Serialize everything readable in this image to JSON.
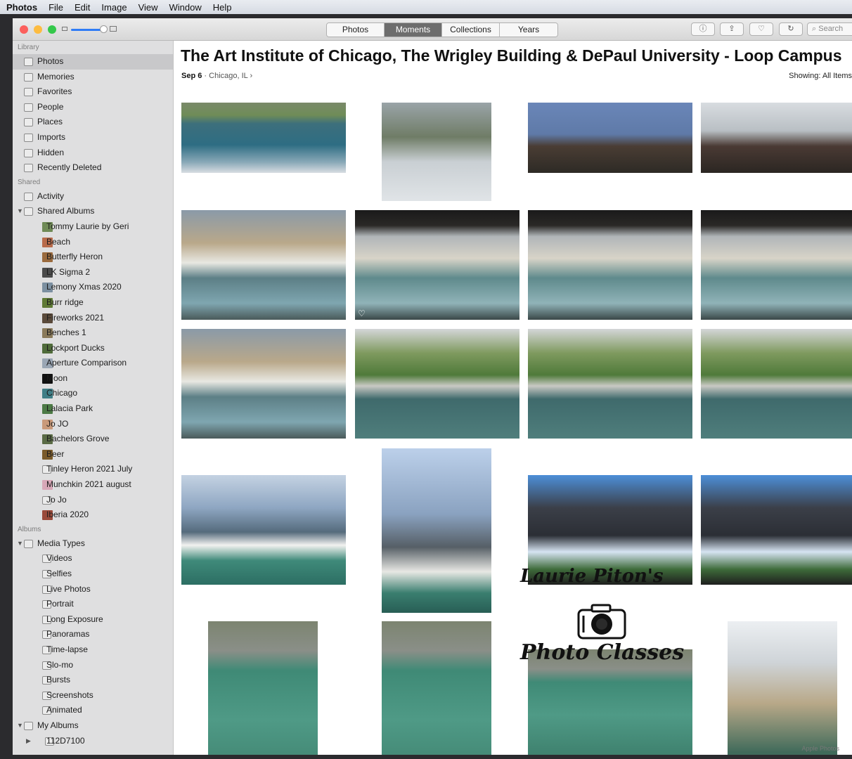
{
  "menubar": {
    "app_name": "Photos",
    "items": [
      "File",
      "Edit",
      "Image",
      "View",
      "Window",
      "Help"
    ]
  },
  "toolbar": {
    "tabs": [
      "Photos",
      "Moments",
      "Collections",
      "Years"
    ],
    "active_tab": "Moments",
    "buttons": [
      {
        "name": "info-button",
        "icon": "info-icon",
        "glyph": "ⓘ"
      },
      {
        "name": "share-button",
        "icon": "share-icon",
        "glyph": "⇪"
      },
      {
        "name": "favorite-button",
        "icon": "heart-icon",
        "glyph": "♡"
      },
      {
        "name": "rotate-button",
        "icon": "rotate-icon",
        "glyph": "↻"
      }
    ],
    "search_placeholder": "Search"
  },
  "sidebar": {
    "sections": [
      {
        "header": "Library",
        "items": [
          {
            "label": "Photos",
            "icon": "photos-icon",
            "selected": true
          },
          {
            "label": "Memories",
            "icon": "memories-icon"
          },
          {
            "label": "Favorites",
            "icon": "heart-icon"
          },
          {
            "label": "People",
            "icon": "person-icon"
          },
          {
            "label": "Places",
            "icon": "pin-icon"
          },
          {
            "label": "Imports",
            "icon": "clock-icon"
          },
          {
            "label": "Hidden",
            "icon": "hidden-icon"
          },
          {
            "label": "Recently Deleted",
            "icon": "trash-icon"
          }
        ]
      },
      {
        "header": "Shared",
        "items": [
          {
            "label": "Activity",
            "icon": "cloud-icon"
          },
          {
            "label": "Shared Albums",
            "icon": "folder-icon",
            "disclosure": "open"
          },
          {
            "label": "Tommy Laurie by Geri",
            "thumb": "#6f8a56",
            "indent": 1
          },
          {
            "label": "Beach",
            "thumb": "#b86b4b",
            "indent": 1
          },
          {
            "label": "Butterfly Heron",
            "thumb": "#9a6a3d",
            "indent": 1
          },
          {
            "label": "LK Sigma 2",
            "thumb": "#4a4a4a",
            "indent": 1
          },
          {
            "label": "Lemony Xmas 2020",
            "thumb": "#7b8fa0",
            "indent": 1
          },
          {
            "label": "Burr ridge",
            "thumb": "#5f7a35",
            "indent": 1
          },
          {
            "label": "Fireworks 2021",
            "thumb": "#5a4a3a",
            "indent": 1
          },
          {
            "label": "Benches 1",
            "thumb": "#8a7a5a",
            "indent": 1
          },
          {
            "label": "Lockport Ducks",
            "thumb": "#4f6b3a",
            "indent": 1
          },
          {
            "label": "Aperture Comparison",
            "thumb": "#9aa6b4",
            "indent": 1
          },
          {
            "label": "Moon",
            "thumb": "#111111",
            "indent": 1
          },
          {
            "label": "Chicago",
            "thumb": "#3f7e86",
            "indent": 1
          },
          {
            "label": "Lalacia Park",
            "thumb": "#4c7a45",
            "indent": 1
          },
          {
            "label": "Jo JO",
            "thumb": "#c99a7a",
            "indent": 1
          },
          {
            "label": "Bachelors Grove",
            "thumb": "#5a6b45",
            "indent": 1
          },
          {
            "label": "Beer",
            "thumb": "#7a5a2a",
            "indent": 1
          },
          {
            "label": "Tinley Heron 2021 July",
            "icon": "album-icon",
            "indent": 1
          },
          {
            "label": "Munchkin 2021 august",
            "thumb": "#d8a8b8",
            "indent": 1
          },
          {
            "label": "Jo Jo",
            "icon": "album-icon",
            "indent": 1
          },
          {
            "label": "Iberia 2020",
            "thumb": "#9a4a3a",
            "indent": 1
          }
        ]
      },
      {
        "header": "Albums",
        "items": [
          {
            "label": "Media Types",
            "icon": "folder-icon",
            "disclosure": "open"
          },
          {
            "label": "Videos",
            "icon": "video-icon",
            "indent": 1
          },
          {
            "label": "Selfies",
            "icon": "camera-icon",
            "indent": 1
          },
          {
            "label": "Live Photos",
            "icon": "live-icon",
            "indent": 1
          },
          {
            "label": "Portrait",
            "icon": "cube-icon",
            "indent": 1
          },
          {
            "label": "Long Exposure",
            "icon": "exposure-icon",
            "indent": 1
          },
          {
            "label": "Panoramas",
            "icon": "panorama-icon",
            "indent": 1
          },
          {
            "label": "Time-lapse",
            "icon": "timelapse-icon",
            "indent": 1
          },
          {
            "label": "Slo-mo",
            "icon": "slomo-icon",
            "indent": 1
          },
          {
            "label": "Bursts",
            "icon": "bursts-icon",
            "indent": 1
          },
          {
            "label": "Screenshots",
            "icon": "phone-icon",
            "indent": 1
          },
          {
            "label": "Animated",
            "icon": "animated-icon",
            "indent": 1
          },
          {
            "label": "My Albums",
            "icon": "folder-icon",
            "disclosure": "open"
          },
          {
            "label": "112D7100",
            "icon": "folder-icon",
            "indent": 1,
            "disclosure": "closed"
          }
        ]
      }
    ]
  },
  "moment": {
    "title": "The Art Institute of Chicago, The Wrigley Building & DePaul University - Loop Campus",
    "date": "Sep 6",
    "separator": "·",
    "location": "Chicago, IL",
    "chevron": "›",
    "showing": "Showing: All Items"
  },
  "watermark": {
    "line1": "Laurie Piton's",
    "line2": "Photo Classes"
  },
  "credit": "Apple Photos",
  "photos": [
    {
      "scene": "river-boats",
      "favorite": false
    },
    {
      "scene": "street-walker",
      "favorite": false
    },
    {
      "scene": "bridge-towers",
      "favorite": false
    },
    {
      "scene": "bridge-facade",
      "favorite": false
    },
    {
      "scene": "riverboat",
      "favorite": false
    },
    {
      "scene": "riverboat-underbridge",
      "favorite": true
    },
    {
      "scene": "riverboat-underbridge",
      "favorite": false
    },
    {
      "scene": "riverboat-underbridge",
      "favorite": false
    },
    {
      "scene": "riverboat",
      "favorite": false
    },
    {
      "scene": "riverwalk-speedboat",
      "favorite": false
    },
    {
      "scene": "riverwalk-speedboat",
      "favorite": false
    },
    {
      "scene": "riverwalk-speedboat",
      "favorite": false
    },
    {
      "scene": "trump-tower-boat",
      "favorite": false
    },
    {
      "scene": "trump-tower-tall",
      "favorite": false
    },
    {
      "scene": "dark-towers",
      "favorite": false
    },
    {
      "scene": "dark-towers",
      "favorite": false
    },
    {
      "scene": "kayakers",
      "favorite": false
    },
    {
      "scene": "kayakers",
      "favorite": false
    },
    {
      "scene": "kayakers",
      "favorite": false
    },
    {
      "scene": "wrigley-tower",
      "favorite": false
    }
  ],
  "colors": {
    "sidebar_bg": "#dfdfe0",
    "selected_row": "#c8c8ca",
    "segment_active": "#6d6d6d",
    "slider_accent": "#2f7cf6",
    "close": "#fc605c",
    "minimize": "#fdbc40",
    "maximize": "#34c84a"
  }
}
